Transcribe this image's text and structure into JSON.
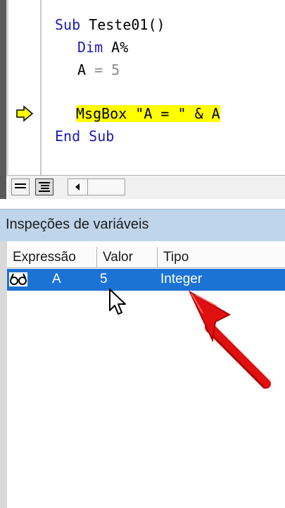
{
  "code": {
    "line1_kw": "Sub ",
    "line1_rest": "Teste01()",
    "line2_kw": "Dim ",
    "line2_rest": "A%",
    "line3_name": "A",
    "line3_rest": " = 5",
    "line4": "MsgBox \"A = \" & A",
    "line5": "End Sub"
  },
  "watch": {
    "title": "Inspeções de variáveis",
    "columns": [
      "Expressão",
      "Valor",
      "Tipo"
    ],
    "rows": [
      {
        "expression": "A",
        "value": "5",
        "type": "Integer"
      }
    ]
  },
  "icons": {
    "execution_marker": "current-line-arrow-icon",
    "watch_row_icon": "glasses-icon",
    "cursor": "mouse-pointer-icon",
    "annotation": "red-arrow-annotation"
  },
  "colors": {
    "keyword": "#1a1ab4",
    "highlight": "#ffff00",
    "selection": "#1c73d6",
    "title_bar": "#bfd5ea"
  }
}
